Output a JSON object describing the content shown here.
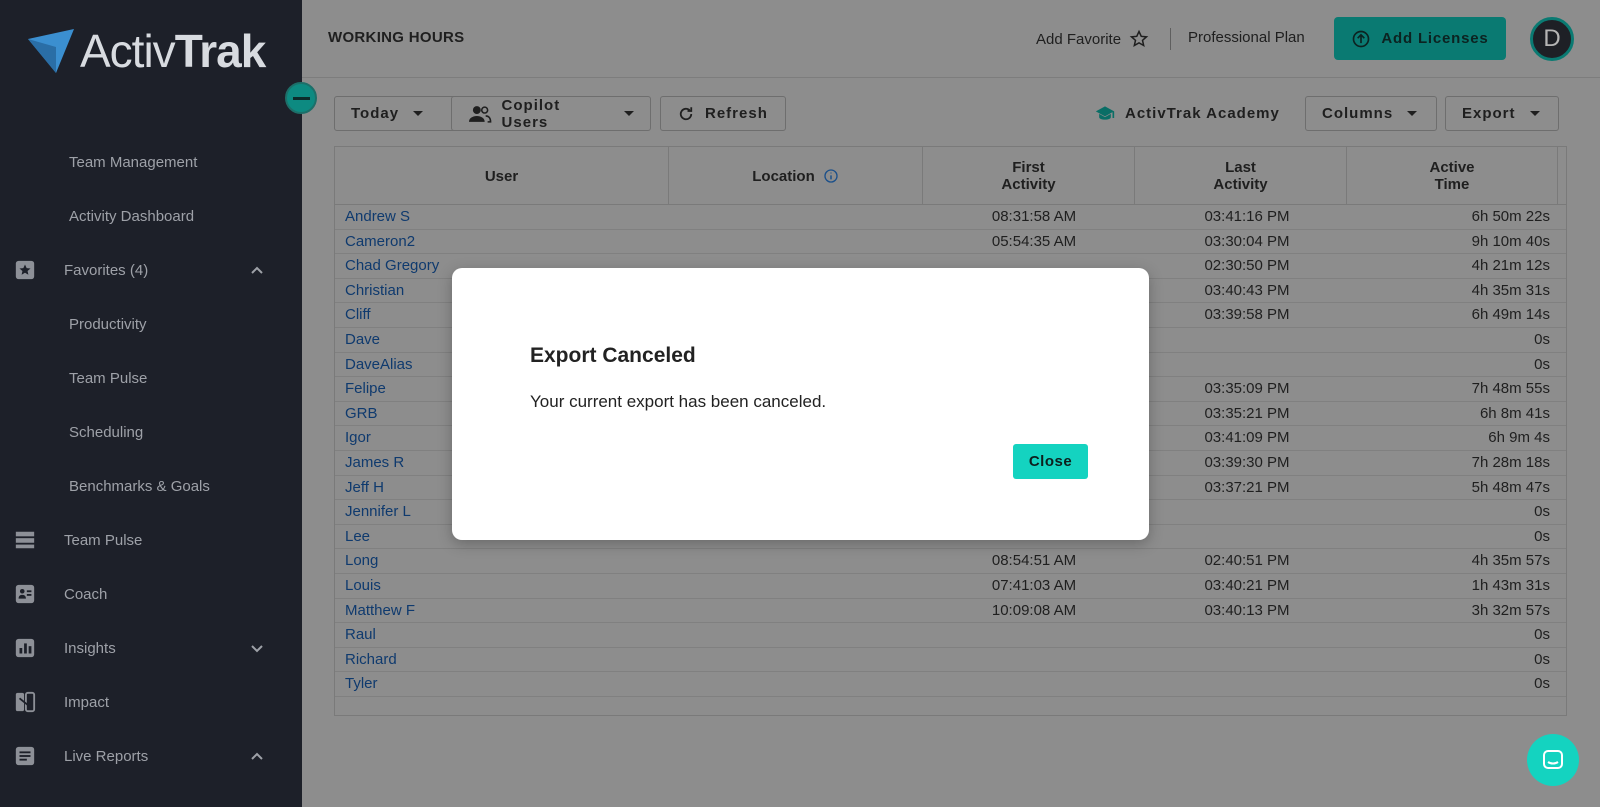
{
  "brand": {
    "logo_text_light": "Activ",
    "logo_text_bold": "Trak",
    "accent_color": "#14d3c0"
  },
  "sidebar": {
    "items": [
      {
        "label": "Team Management",
        "type": "sub"
      },
      {
        "label": "Activity Dashboard",
        "type": "sub"
      },
      {
        "label": "Favorites (4)",
        "type": "top",
        "icon": "star-icon",
        "chevron": "up"
      },
      {
        "label": "Productivity",
        "type": "sub"
      },
      {
        "label": "Team Pulse",
        "type": "sub"
      },
      {
        "label": "Scheduling",
        "type": "sub"
      },
      {
        "label": "Benchmarks & Goals",
        "type": "sub"
      },
      {
        "label": "Team Pulse",
        "type": "top",
        "icon": "pulse-icon"
      },
      {
        "label": "Coach",
        "type": "top",
        "icon": "coach-icon"
      },
      {
        "label": "Insights",
        "type": "top",
        "icon": "insights-icon",
        "chevron": "down"
      },
      {
        "label": "Impact",
        "type": "top",
        "icon": "impact-icon"
      },
      {
        "label": "Live Reports",
        "type": "top",
        "icon": "reports-icon",
        "chevron": "up"
      }
    ]
  },
  "header": {
    "title": "WORKING HOURS",
    "add_favorite": "Add Favorite",
    "plan": "Professional Plan",
    "add_licenses": "Add Licenses",
    "avatar_initial": "D"
  },
  "toolbar": {
    "today": "Today",
    "users_filter": "Copilot Users",
    "refresh": "Refresh",
    "academy": "ActivTrak Academy",
    "columns": "Columns",
    "export": "Export"
  },
  "table": {
    "headers": {
      "user": "User",
      "location": "Location",
      "first_activity": "First\nActivity",
      "last_activity": "Last\nActivity",
      "active_time": "Active\nTime"
    },
    "rows": [
      {
        "user": "Andrew S",
        "first": "08:31:58 AM",
        "last": "03:41:16 PM",
        "active": "6h 50m 22s"
      },
      {
        "user": "Cameron2",
        "first": "05:54:35 AM",
        "last": "03:30:04 PM",
        "active": "9h 10m 40s"
      },
      {
        "user": "Chad Gregory",
        "first": "",
        "last": "02:30:50 PM",
        "active": "4h 21m 12s"
      },
      {
        "user": "Christian",
        "first": "",
        "last": "03:40:43 PM",
        "active": "4h 35m 31s"
      },
      {
        "user": "Cliff",
        "first": "",
        "last": "03:39:58 PM",
        "active": "6h 49m 14s"
      },
      {
        "user": "Dave",
        "first": "",
        "last": "",
        "active": "0s"
      },
      {
        "user": "DaveAlias",
        "first": "",
        "last": "",
        "active": "0s"
      },
      {
        "user": "Felipe",
        "first": "",
        "last": "03:35:09 PM",
        "active": "7h 48m 55s"
      },
      {
        "user": "GRB",
        "first": "",
        "last": "03:35:21 PM",
        "active": "6h 8m 41s"
      },
      {
        "user": "Igor",
        "first": "",
        "last": "03:41:09 PM",
        "active": "6h 9m 4s"
      },
      {
        "user": "James R",
        "first": "",
        "last": "03:39:30 PM",
        "active": "7h 28m 18s"
      },
      {
        "user": "Jeff H",
        "first": "",
        "last": "03:37:21 PM",
        "active": "5h 48m 47s"
      },
      {
        "user": "Jennifer L",
        "first": "",
        "last": "",
        "active": "0s"
      },
      {
        "user": "Lee",
        "first": "",
        "last": "",
        "active": "0s"
      },
      {
        "user": "Long",
        "first": "08:54:51 AM",
        "last": "02:40:51 PM",
        "active": "4h 35m 57s"
      },
      {
        "user": "Louis",
        "first": "07:41:03 AM",
        "last": "03:40:21 PM",
        "active": "1h 43m 31s"
      },
      {
        "user": "Matthew F",
        "first": "10:09:08 AM",
        "last": "03:40:13 PM",
        "active": "3h 32m 57s"
      },
      {
        "user": "Raul",
        "first": "",
        "last": "",
        "active": "0s"
      },
      {
        "user": "Richard",
        "first": "",
        "last": "",
        "active": "0s"
      },
      {
        "user": "Tyler",
        "first": "",
        "last": "",
        "active": "0s"
      }
    ]
  },
  "modal": {
    "title": "Export Canceled",
    "message": "Your current export has been canceled.",
    "close_label": "Close"
  }
}
